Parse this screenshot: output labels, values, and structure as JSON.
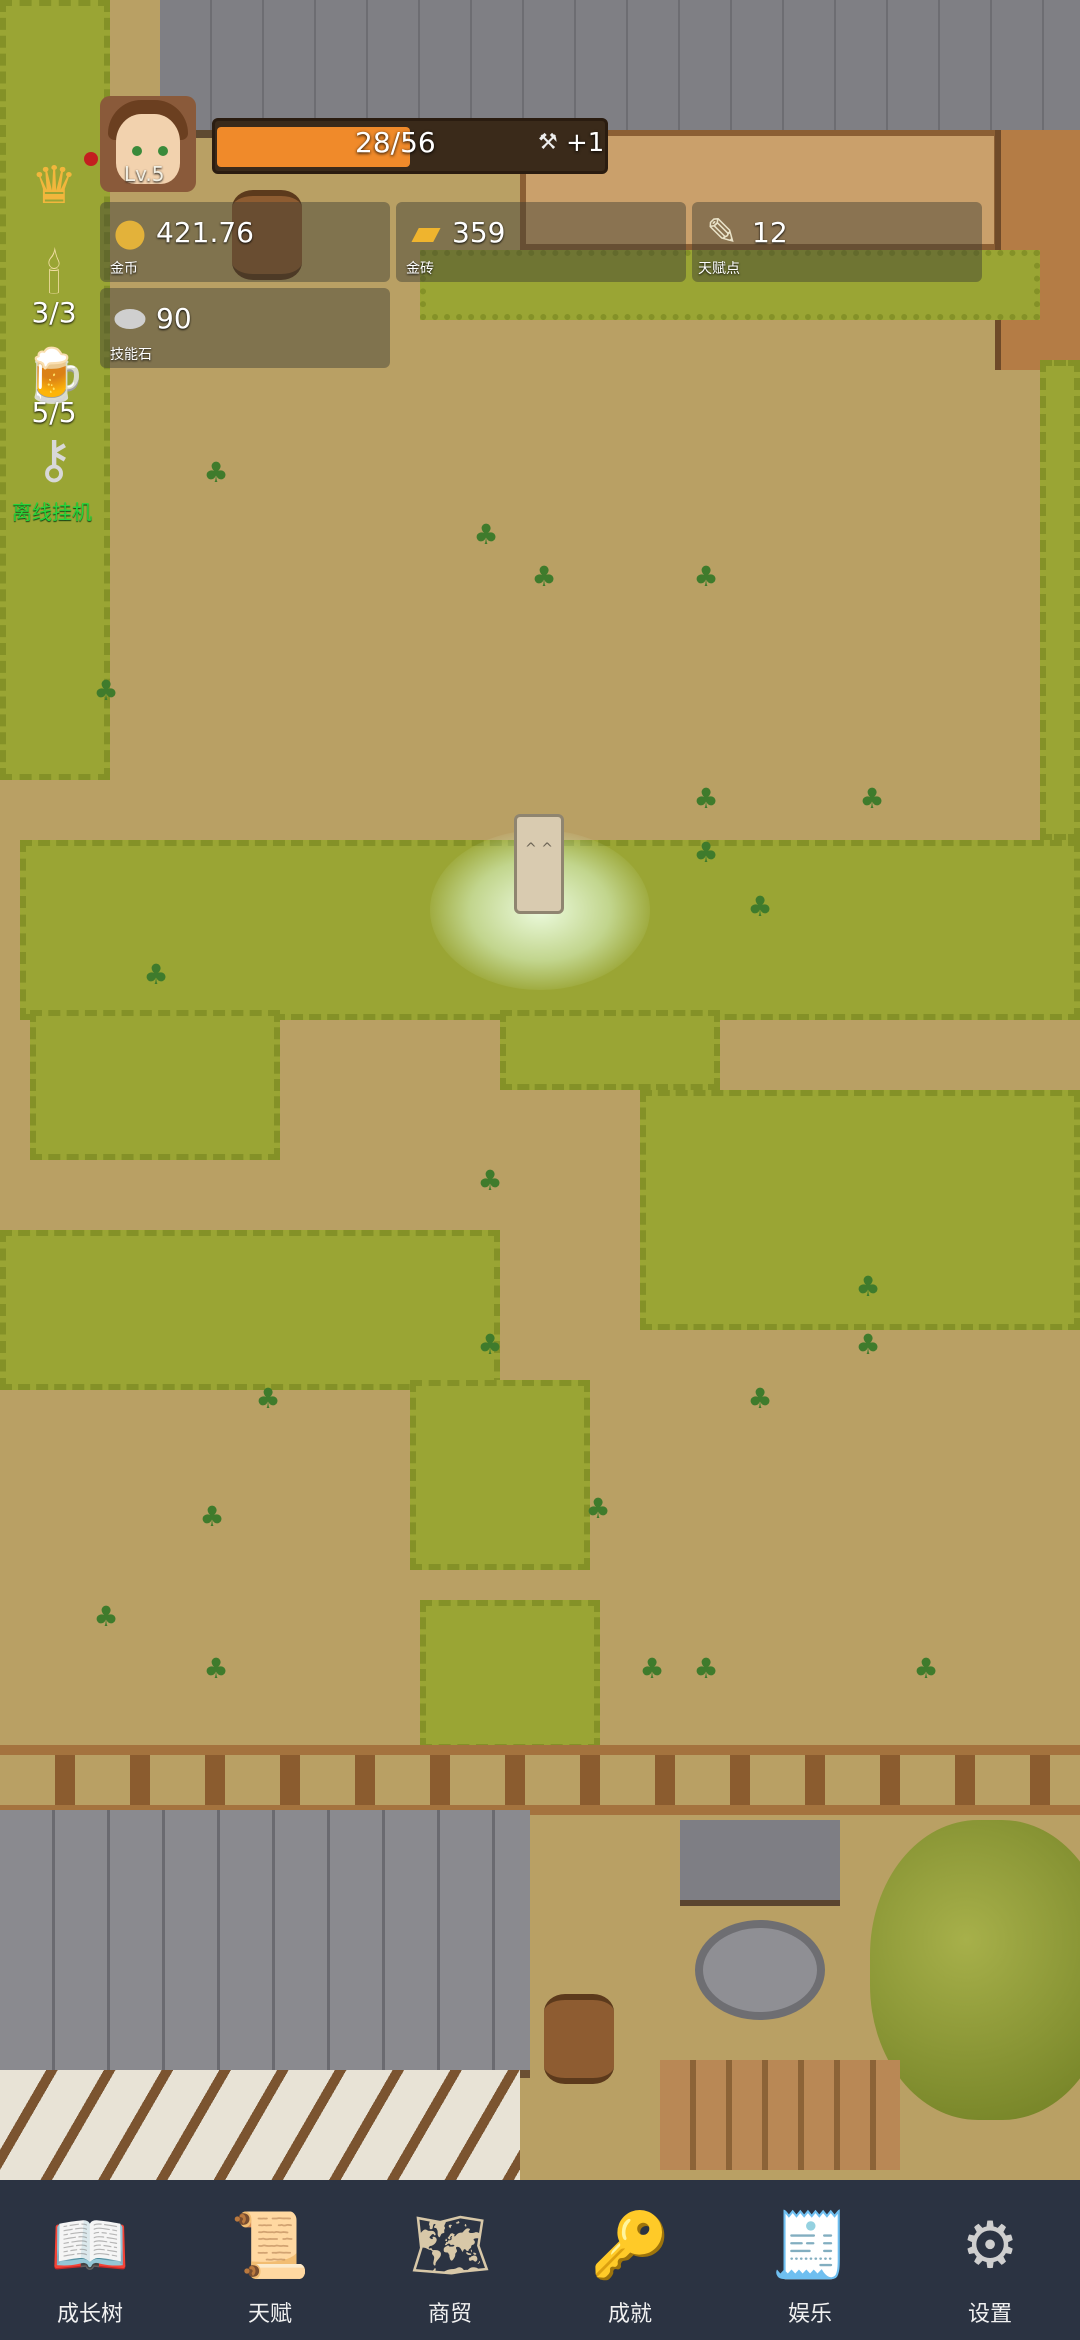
{
  "player": {
    "level": "Lv.5",
    "hp_text": "28/56",
    "hp_fraction": 0.5,
    "hp_regen": "+1"
  },
  "resources": {
    "gold": {
      "value": "421.76",
      "label": "金币",
      "icon": "gold-coin-icon"
    },
    "gold_brick": {
      "value": "359",
      "label": "金砖",
      "icon": "gold-brick-icon"
    },
    "talent_points": {
      "value": "12",
      "label": "天赋点",
      "icon": "scroll-icon"
    },
    "skill_stones": {
      "value": "90",
      "label": "技能石",
      "icon": "stone-icon"
    }
  },
  "side": {
    "candle_count": "3/3",
    "beer_count": "5/5",
    "idle_label": "离线挂机"
  },
  "nav": [
    {
      "label": "成长树",
      "icon": "book-icon"
    },
    {
      "label": "天赋",
      "icon": "scroll-icon"
    },
    {
      "label": "商贸",
      "icon": "map-icon"
    },
    {
      "label": "成就",
      "icon": "key-icon"
    },
    {
      "label": "娱乐",
      "icon": "parchment-icon"
    },
    {
      "label": "设置",
      "icon": "gear-icon"
    }
  ],
  "colors": {
    "hp_fill": "#f08a2a",
    "nav_bg": "#2b3342",
    "idle_label": "#27d43a",
    "grass": "#9aa534",
    "dirt": "#b9a064"
  }
}
